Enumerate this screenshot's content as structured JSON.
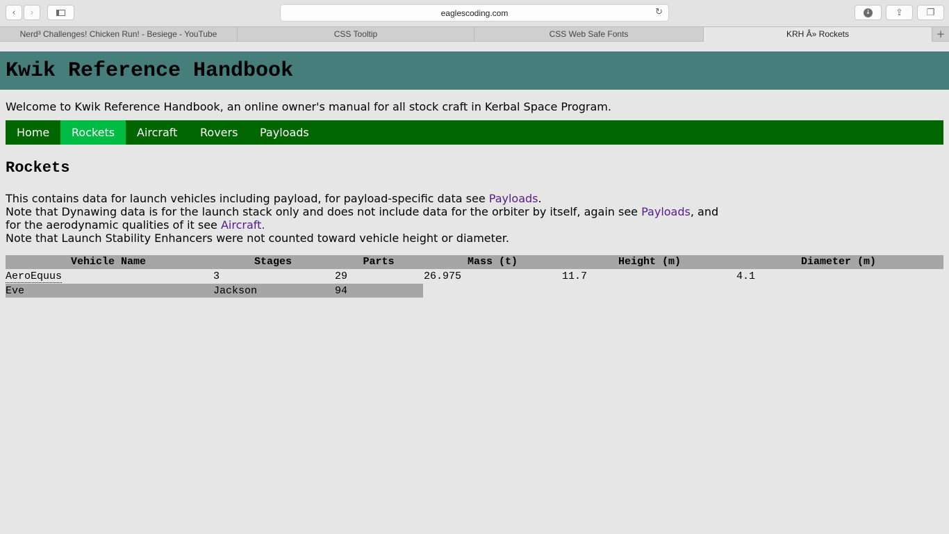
{
  "browser": {
    "url": "eaglescoding.com",
    "tabs": [
      {
        "label": "Nerd³ Challenges! Chicken Run! - Besiege - YouTube"
      },
      {
        "label": "CSS Tooltip"
      },
      {
        "label": "CSS Web Safe Fonts"
      },
      {
        "label": "KRH Â» Rockets"
      }
    ],
    "new_tab": "+"
  },
  "site": {
    "title": "Kwik Reference Handbook",
    "welcome": "Welcome to Kwik Reference Handbook, an online owner's manual for all stock craft in Kerbal Space Program."
  },
  "nav": {
    "items": [
      "Home",
      "Rockets",
      "Aircraft",
      "Rovers",
      "Payloads"
    ],
    "active": "Rockets"
  },
  "page": {
    "title": "Rockets",
    "line1_pre": "This contains data for launch vehicles including payload, for payload-specific data see ",
    "line1_link": "Payloads",
    "line1_post": ".",
    "line2_pre": "Note that Dynawing data is for the launch stack only and does not include data for the orbiter by itself, again see ",
    "line2_link": "Payloads",
    "line2_post": ", and",
    "line3_pre": "for the aerodynamic qualities of it see ",
    "line3_link": "Aircraft.",
    "line4": "Note that Launch Stability Enhancers were not counted toward vehicle height or diameter."
  },
  "table": {
    "headers": [
      "Vehicle Name",
      "Stages",
      "Parts",
      "Mass (t)",
      "Height (m)",
      "Diameter (m)"
    ],
    "rows": [
      [
        "AeroEquus",
        "3",
        "29",
        "26.975",
        "11.7",
        "4.1"
      ],
      [
        "Eve",
        "Jackson",
        "94"
      ]
    ]
  },
  "colors": {
    "header_bg": "#467e7b",
    "nav_bg": "#006600",
    "nav_active": "#00bb44",
    "link": "#551a8b",
    "table_header_bg": "#a6a6a6"
  }
}
